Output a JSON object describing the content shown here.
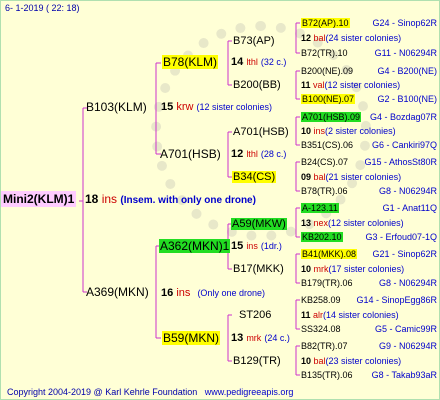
{
  "date": "6-  1-2019  ( 22:  18)",
  "root": {
    "name": "Mini2(KLM)1",
    "num": "18",
    "ins": "ins",
    "note": "(Insem. with only one drone)"
  },
  "gen1": [
    {
      "name": "B103(KLM)",
      "num": "15",
      "krw": "krw",
      "note": "(12 sister colonies)"
    },
    {
      "name": "A369(MKN)",
      "num": "16",
      "ins": "ins",
      "note": "(Only one drone)"
    }
  ],
  "gen2": [
    {
      "name": "B78(KLM)",
      "num": "14",
      "tag": "lthl",
      "note": "(32 c.)"
    },
    {
      "name": "A701(HSB)",
      "num": "12",
      "tag": "lthl",
      "note": "(28 c.)"
    },
    {
      "name": "A362(MKN)1",
      "num": "15",
      "tag": "ins",
      "note": "(1dr.)"
    },
    {
      "name": "B59(MKN)",
      "num": "13",
      "tag": "mrk",
      "note": "(24 c.)"
    }
  ],
  "gen3": [
    {
      "name": "B73(AP)"
    },
    {
      "name": "B200(BB)",
      "num": "11",
      "tag": "val",
      "note": "(12 sister colonies)"
    },
    {
      "name": "A701(HSB)"
    },
    {
      "name": "B34(CS)"
    },
    {
      "name": "A59(MKW)"
    },
    {
      "name": "B17(MKK)"
    },
    {
      "name": "ST206"
    },
    {
      "name": "B129(TR)"
    }
  ],
  "gen3_mid": [
    {
      "num": "14",
      "tag": "lthl",
      "note": "(32 c.)"
    }
  ],
  "gen4": [
    {
      "name": "B72(AP).10",
      "right": "G24 - Sinop62R"
    },
    {
      "num": "12",
      "tag": "bal",
      "note": "(24 sister colonies)"
    },
    {
      "name": "B72(TR).10",
      "right": "G11 - N06294R"
    },
    {
      "name": "B200(NE).09",
      "right": "G4 - B200(NE)"
    },
    {
      "num": "11",
      "tag": "val",
      "note": "(12 sister colonies)"
    },
    {
      "name": "B100(NE).07",
      "right": "G2 - B100(NE)"
    },
    {
      "name": "A701(HSB).09",
      "right": "G4 - Bozdag07R"
    },
    {
      "num": "10",
      "tag": "ins",
      "note": "(2 sister colonies)"
    },
    {
      "name": "B351(CS).06",
      "right": "G6 - Cankiri97Q"
    },
    {
      "name": "B24(CS).07",
      "right": "G15 - AthosSt80R"
    },
    {
      "num": "09",
      "tag": "bal",
      "note": "(21 sister colonies)"
    },
    {
      "name": "B78(TR).06",
      "right": "G8 - N06294R"
    },
    {
      "name": "A-123.11",
      "right": "G1 - Anat11Q"
    },
    {
      "num": "13",
      "tag": "nex",
      "note": "(12 sister colonies)"
    },
    {
      "name": "KB202.10",
      "right": "G3 - Erfoud07-1Q"
    },
    {
      "name": "B41(MKK).08",
      "right": "G21 - Sinop62R"
    },
    {
      "num": "10",
      "tag": "mrk",
      "note": "(17 sister colonies)"
    },
    {
      "name": "B179(TR).06",
      "right": "G8 - N06294R"
    },
    {
      "name": "KB258.09",
      "right": "G14 - SinopEgg86R"
    },
    {
      "num": "11",
      "tag": "alr",
      "note": "(14 sister colonies)"
    },
    {
      "name": "SS324.08",
      "right": "G5 - Camic99R"
    },
    {
      "name": "B82(TR).07",
      "right": "G9 - N06294R"
    },
    {
      "num": "10",
      "tag": "bal",
      "note": "(23 sister colonies)"
    },
    {
      "name": "B135(TR).06",
      "right": "G8 - Takab93aR"
    }
  ],
  "copyright": {
    "text": "Copyright 2004-2019 @ Karl Kehrle Foundation",
    "site": "www.pedigreeapis.org"
  },
  "colors": {
    "background": "#ffffd6",
    "highlight_yellow": "#ffff00",
    "highlight_green": "#22dd22",
    "root_pink": "#ffccff",
    "line": "#cc33cc"
  }
}
